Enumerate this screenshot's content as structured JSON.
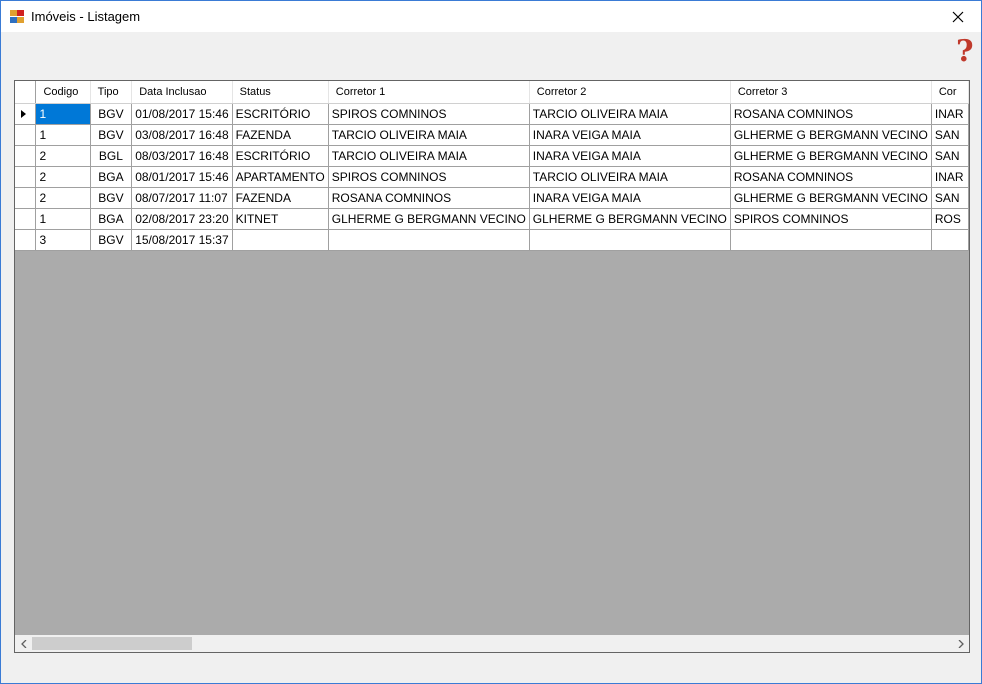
{
  "window": {
    "title": "Imóveis - Listagem"
  },
  "help": {
    "glyph": "?",
    "color": "#c0392b"
  },
  "grid": {
    "columns": [
      "Codigo",
      "Tipo",
      "Data Inclusao",
      "Status",
      "Corretor 1",
      "Corretor 2",
      "Corretor 3",
      "Cor"
    ],
    "rows": [
      [
        "1",
        "BGV",
        "01/08/2017 15:46",
        "ESCRITÓRIO",
        "SPIROS COMNINOS",
        "TARCIO OLIVEIRA MAIA",
        "ROSANA COMNINOS",
        "INAR"
      ],
      [
        "1",
        "BGV",
        "03/08/2017 16:48",
        "FAZENDA",
        "TARCIO OLIVEIRA MAIA",
        "INARA VEIGA MAIA",
        "GLHERME G BERGMANN VECINO",
        "SAN"
      ],
      [
        "2",
        "BGL",
        "08/03/2017 16:48",
        "ESCRITÓRIO",
        "TARCIO OLIVEIRA MAIA",
        "INARA VEIGA MAIA",
        "GLHERME G BERGMANN VECINO",
        "SAN"
      ],
      [
        "2",
        "BGA",
        "08/01/2017 15:46",
        "APARTAMENTO",
        "SPIROS COMNINOS",
        "TARCIO OLIVEIRA MAIA",
        "ROSANA COMNINOS",
        "INAR"
      ],
      [
        "2",
        "BGV",
        "08/07/2017 11:07",
        "FAZENDA",
        "ROSANA COMNINOS",
        "INARA VEIGA MAIA",
        "GLHERME G BERGMANN VECINO",
        "SAN"
      ],
      [
        "1",
        "BGA",
        "02/08/2017 23:20",
        "KITNET",
        "GLHERME G BERGMANN VECINO",
        "GLHERME G BERGMANN VECINO",
        "SPIROS COMNINOS",
        "ROS"
      ],
      [
        "3",
        "BGV",
        "15/08/2017 15:37",
        "",
        "",
        "",
        "",
        ""
      ]
    ],
    "selected_row": 0,
    "selected_color": "#0078d7"
  }
}
